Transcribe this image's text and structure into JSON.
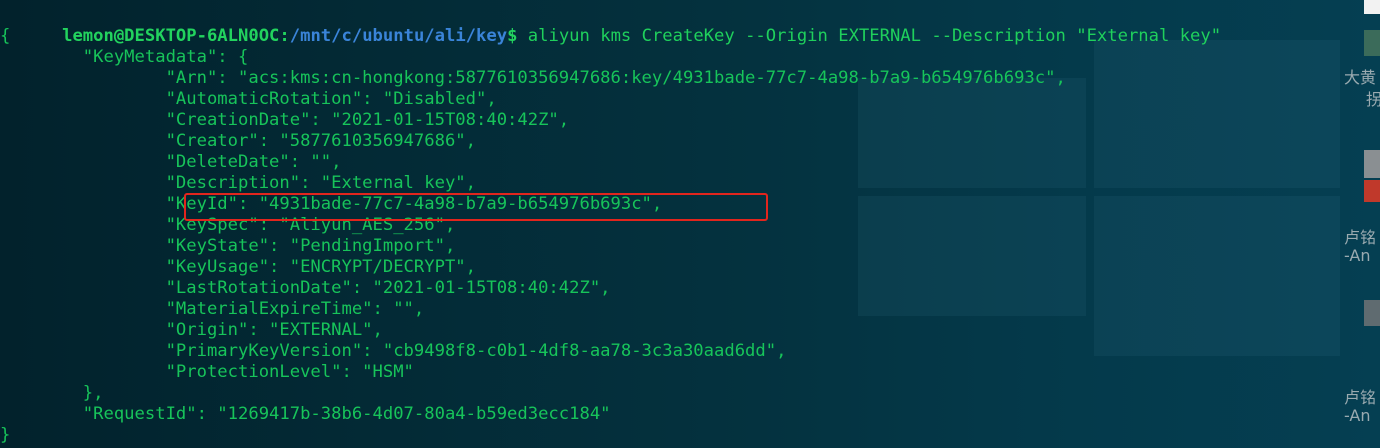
{
  "terminal": {
    "prompt": {
      "user_host": "lemon@DESKTOP-6ALN0OC",
      "separator": ":",
      "path": "/mnt/c/ubuntu/ali/key",
      "symbol": "$"
    },
    "command": " aliyun kms CreateKey --Origin EXTERNAL --Description \"External key\"",
    "output_lines": [
      "{",
      "        \"KeyMetadata\": {",
      "                \"Arn\": \"acs:kms:cn-hongkong:5877610356947686:key/4931bade-77c7-4a98-b7a9-b654976b693c\",",
      "                \"AutomaticRotation\": \"Disabled\",",
      "                \"CreationDate\": \"2021-01-15T08:40:42Z\",",
      "                \"Creator\": \"5877610356947686\",",
      "                \"DeleteDate\": \"\",",
      "                \"Description\": \"External key\",",
      "                \"KeyId\": \"4931bade-77c7-4a98-b7a9-b654976b693c\",",
      "                \"KeySpec\": \"Aliyun_AES_256\",",
      "                \"KeyState\": \"PendingImport\",",
      "                \"KeyUsage\": \"ENCRYPT/DECRYPT\",",
      "                \"LastRotationDate\": \"2021-01-15T08:40:42Z\",",
      "                \"MaterialExpireTime\": \"\",",
      "                \"Origin\": \"EXTERNAL\",",
      "                \"PrimaryKeyVersion\": \"cb9498f8-c0b1-4df8-aa78-3c3a30aad6dd\",",
      "                \"ProtectionLevel\": \"HSM\"",
      "        },",
      "        \"RequestId\": \"1269417b-38b6-4d07-80a4-b59ed3ecc184\"",
      "}"
    ],
    "highlighted_key": "KeyId"
  },
  "side_panel": {
    "items": [
      {
        "text": "大黄"
      },
      {
        "text": "拐"
      },
      {
        "text": "卢铭"
      },
      {
        "text": "-An"
      },
      {
        "text": "卢铭"
      },
      {
        "text": "-An"
      }
    ]
  },
  "colors": {
    "terminal_text": "#17c45a",
    "prompt_path": "#3a84d8",
    "highlight_border": "#e2251d",
    "background": "#04303c"
  }
}
